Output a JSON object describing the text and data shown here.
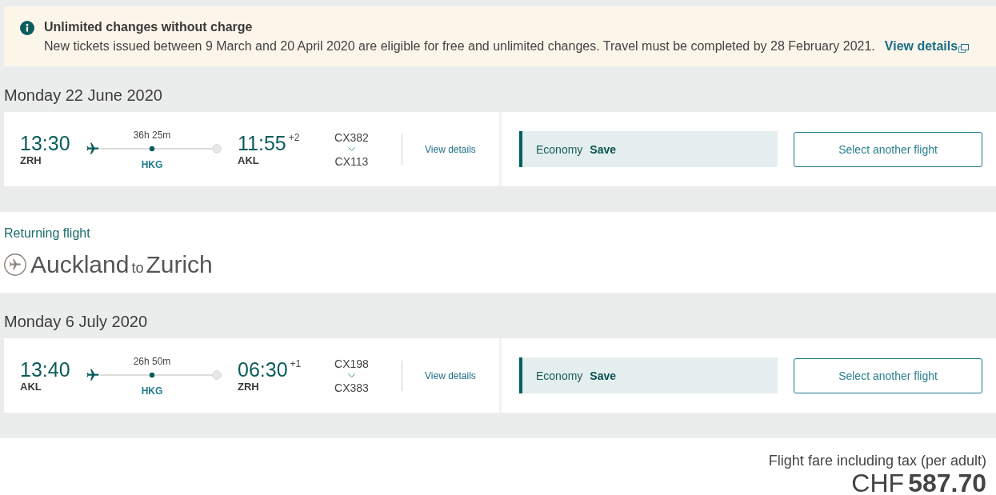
{
  "notice": {
    "title": "Unlimited changes without charge",
    "text": "New tickets issued between 9 March and 20 April 2020 are eligible for free and unlimited changes. Travel must be completed by 28 February 2021.",
    "link": "View details"
  },
  "journeys": [
    {
      "date": "Monday 22 June 2020",
      "departure": {
        "time": "13:30",
        "airport": "ZRH"
      },
      "duration": "36h 25m",
      "stop": "HKG",
      "arrival": {
        "time": "11:55",
        "day_offset": "+2",
        "airport": "AKL"
      },
      "flight_numbers": [
        "CX382",
        "CX113"
      ],
      "details_link": "View details",
      "fare": {
        "cabin": "Economy",
        "brand": "Save"
      },
      "button": "Select another flight"
    },
    {
      "heading": {
        "label": "Returning flight",
        "origin": "Auckland",
        "connector": "to",
        "destination": "Zurich"
      },
      "date": "Monday 6 July 2020",
      "departure": {
        "time": "13:40",
        "airport": "AKL"
      },
      "duration": "26h 50m",
      "stop": "HKG",
      "arrival": {
        "time": "06:30",
        "day_offset": "+1",
        "airport": "ZRH"
      },
      "flight_numbers": [
        "CX198",
        "CX383"
      ],
      "details_link": "View details",
      "fare": {
        "cabin": "Economy",
        "brand": "Save"
      },
      "button": "Select another flight"
    }
  ],
  "total": {
    "label": "Flight fare including tax (per adult)",
    "currency": "CHF",
    "amount": "587.70"
  }
}
